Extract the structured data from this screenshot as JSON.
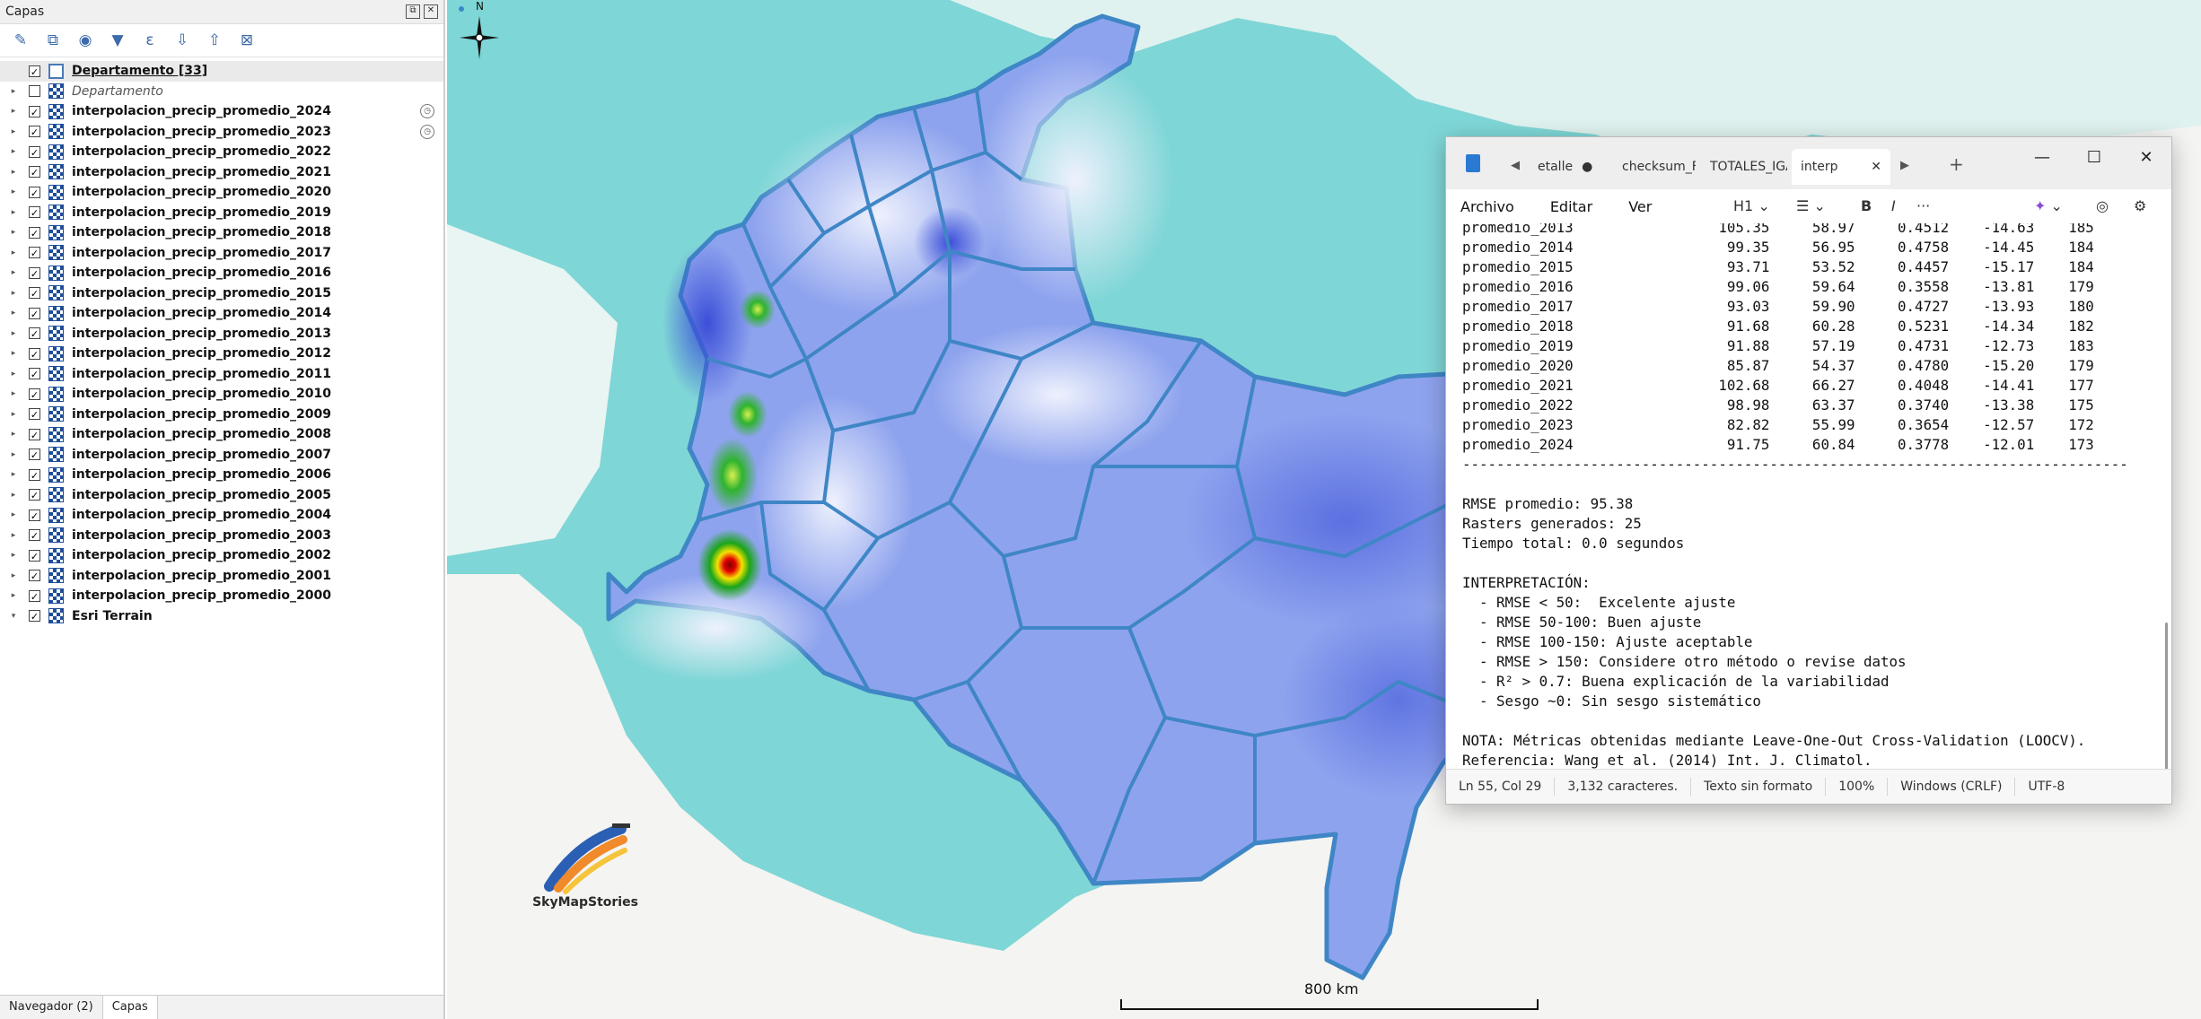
{
  "layers_panel": {
    "title": "Capas",
    "header_buttons": [
      "⧉",
      "✕"
    ],
    "toolbar_icons": [
      "✎",
      "⧉",
      "◉",
      "▼",
      "ε",
      "⇩",
      "⇧",
      "⊠"
    ],
    "layers": [
      {
        "name": "Departamento [33]",
        "checked": true,
        "type": "vector",
        "expand": "",
        "style": "highlight underline",
        "clock": false
      },
      {
        "name": "Departamento",
        "checked": false,
        "type": "raster",
        "expand": "▸",
        "style": "italic",
        "clock": false
      },
      {
        "name": "interpolacion_precip_promedio_2024",
        "checked": true,
        "type": "raster",
        "expand": "▸",
        "style": "",
        "clock": true
      },
      {
        "name": "interpolacion_precip_promedio_2023",
        "checked": true,
        "type": "raster",
        "expand": "▸",
        "style": "",
        "clock": true
      },
      {
        "name": "interpolacion_precip_promedio_2022",
        "checked": true,
        "type": "raster",
        "expand": "▸",
        "style": "",
        "clock": false
      },
      {
        "name": "interpolacion_precip_promedio_2021",
        "checked": true,
        "type": "raster",
        "expand": "▸",
        "style": "",
        "clock": false
      },
      {
        "name": "interpolacion_precip_promedio_2020",
        "checked": true,
        "type": "raster",
        "expand": "▸",
        "style": "",
        "clock": false
      },
      {
        "name": "interpolacion_precip_promedio_2019",
        "checked": true,
        "type": "raster",
        "expand": "▸",
        "style": "",
        "clock": false
      },
      {
        "name": "interpolacion_precip_promedio_2018",
        "checked": true,
        "type": "raster",
        "expand": "▸",
        "style": "",
        "clock": false
      },
      {
        "name": "interpolacion_precip_promedio_2017",
        "checked": true,
        "type": "raster",
        "expand": "▸",
        "style": "",
        "clock": false
      },
      {
        "name": "interpolacion_precip_promedio_2016",
        "checked": true,
        "type": "raster",
        "expand": "▸",
        "style": "",
        "clock": false
      },
      {
        "name": "interpolacion_precip_promedio_2015",
        "checked": true,
        "type": "raster",
        "expand": "▸",
        "style": "",
        "clock": false
      },
      {
        "name": "interpolacion_precip_promedio_2014",
        "checked": true,
        "type": "raster",
        "expand": "▸",
        "style": "",
        "clock": false
      },
      {
        "name": "interpolacion_precip_promedio_2013",
        "checked": true,
        "type": "raster",
        "expand": "▸",
        "style": "",
        "clock": false
      },
      {
        "name": "interpolacion_precip_promedio_2012",
        "checked": true,
        "type": "raster",
        "expand": "▸",
        "style": "",
        "clock": false
      },
      {
        "name": "interpolacion_precip_promedio_2011",
        "checked": true,
        "type": "raster",
        "expand": "▸",
        "style": "",
        "clock": false
      },
      {
        "name": "interpolacion_precip_promedio_2010",
        "checked": true,
        "type": "raster",
        "expand": "▸",
        "style": "",
        "clock": false
      },
      {
        "name": "interpolacion_precip_promedio_2009",
        "checked": true,
        "type": "raster",
        "expand": "▸",
        "style": "",
        "clock": false
      },
      {
        "name": "interpolacion_precip_promedio_2008",
        "checked": true,
        "type": "raster",
        "expand": "▸",
        "style": "",
        "clock": false
      },
      {
        "name": "interpolacion_precip_promedio_2007",
        "checked": true,
        "type": "raster",
        "expand": "▸",
        "style": "",
        "clock": false
      },
      {
        "name": "interpolacion_precip_promedio_2006",
        "checked": true,
        "type": "raster",
        "expand": "▸",
        "style": "",
        "clock": false
      },
      {
        "name": "interpolacion_precip_promedio_2005",
        "checked": true,
        "type": "raster",
        "expand": "▸",
        "style": "",
        "clock": false
      },
      {
        "name": "interpolacion_precip_promedio_2004",
        "checked": true,
        "type": "raster",
        "expand": "▸",
        "style": "",
        "clock": false
      },
      {
        "name": "interpolacion_precip_promedio_2003",
        "checked": true,
        "type": "raster",
        "expand": "▸",
        "style": "",
        "clock": false
      },
      {
        "name": "interpolacion_precip_promedio_2002",
        "checked": true,
        "type": "raster",
        "expand": "▸",
        "style": "",
        "clock": false
      },
      {
        "name": "interpolacion_precip_promedio_2001",
        "checked": true,
        "type": "raster",
        "expand": "▸",
        "style": "",
        "clock": false
      },
      {
        "name": "interpolacion_precip_promedio_2000",
        "checked": true,
        "type": "raster",
        "expand": "▸",
        "style": "",
        "clock": false
      },
      {
        "name": "Esri Terrain",
        "checked": true,
        "type": "raster",
        "expand": "▾",
        "style": "",
        "clock": false
      }
    ],
    "bottom_tabs": [
      "Navegador (2)",
      "Capas"
    ]
  },
  "map": {
    "north_label": "N",
    "scale_label": "800 km",
    "logo_text": "SkyMapStories",
    "colors": {
      "sea": "#7fd6d6",
      "land": "#f3f3f1",
      "raster": "#8ea3ee",
      "boundary": "#3f86c6"
    }
  },
  "notepad": {
    "tabs": [
      "etalle",
      "checksum_F.",
      "TOTALES_IGA",
      "interp"
    ],
    "menus": [
      "Archivo",
      "Editar",
      "Ver"
    ],
    "heading_tool": "H1",
    "text_lines": [
      "promedio_2013                 105.35     58.97     0.4512    -14.63    185",
      "promedio_2014                  99.35     56.95     0.4758    -14.45    184",
      "promedio_2015                  93.71     53.52     0.4457    -15.17    184",
      "promedio_2016                  99.06     59.64     0.3558    -13.81    179",
      "promedio_2017                  93.03     59.90     0.4727    -13.93    180",
      "promedio_2018                  91.68     60.28     0.5231    -14.34    182",
      "promedio_2019                  91.88     57.19     0.4731    -12.73    183",
      "promedio_2020                  85.87     54.37     0.4780    -15.20    179",
      "promedio_2021                 102.68     66.27     0.4048    -14.41    177",
      "promedio_2022                  98.98     63.37     0.3740    -13.38    175",
      "promedio_2023                  82.82     55.99     0.3654    -12.57    172",
      "promedio_2024                  91.75     60.84     0.3778    -12.01    173",
      "------------------------------------------------------------------------------",
      "",
      "RMSE promedio: 95.38",
      "Rasters generados: 25",
      "Tiempo total: 0.0 segundos",
      "",
      "INTERPRETACIÓN:",
      "  - RMSE < 50:  Excelente ajuste",
      "  - RMSE 50-100: Buen ajuste",
      "  - RMSE 100-150: Ajuste aceptable",
      "  - RMSE > 150: Considere otro método o revise datos",
      "  - R² > 0.7: Buena explicación de la variabilidad",
      "  - Sesgo ~0: Sin sesgo sistemático",
      "",
      "NOTA: Métricas obtenidas mediante Leave-One-Out Cross-Validation (LOOCV).",
      "Referencia: Wang et al. (2014) Int. J. Climatol."
    ],
    "status": {
      "position": "Ln 55, Col 29",
      "chars": "3,132 caracteres.",
      "format": "Texto sin formato",
      "zoom": "100%",
      "eol": "Windows (CRLF)",
      "encoding": "UTF-8"
    }
  }
}
